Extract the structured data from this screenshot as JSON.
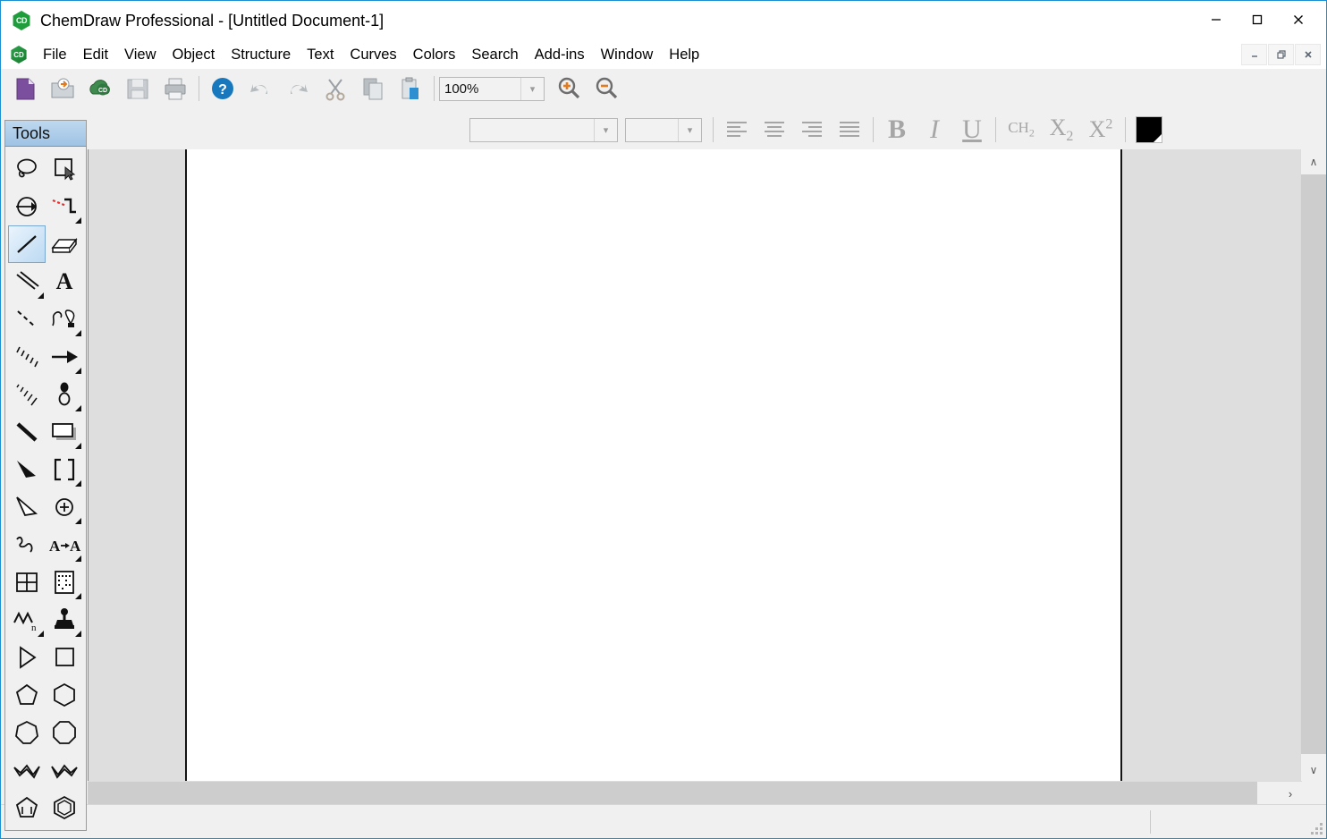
{
  "window": {
    "app_title": "ChemDraw Professional - [Untitled Document-1]",
    "app_icon": "chemdraw-hexagon-icon",
    "icon_text": "CD",
    "controls": {
      "minimize": "—",
      "maximize": "☐",
      "close": "✕"
    }
  },
  "mdi_controls": {
    "minimize": "–",
    "restore": "❐",
    "close": "✕"
  },
  "menu": {
    "icon": "chemdraw-document-icon",
    "icon_text": "CD",
    "items": [
      {
        "label": "File"
      },
      {
        "label": "Edit"
      },
      {
        "label": "View"
      },
      {
        "label": "Object"
      },
      {
        "label": "Structure"
      },
      {
        "label": "Text"
      },
      {
        "label": "Curves"
      },
      {
        "label": "Colors"
      },
      {
        "label": "Search"
      },
      {
        "label": "Add-ins"
      },
      {
        "label": "Window"
      },
      {
        "label": "Help"
      }
    ]
  },
  "main_toolbar": {
    "buttons": [
      {
        "name": "new-document-button",
        "icon": "new-document-icon",
        "enabled": true
      },
      {
        "name": "open-document-button",
        "icon": "open-folder-icon",
        "enabled": true
      },
      {
        "name": "chemdraw-cloud-button",
        "icon": "cloud-icon",
        "enabled": true
      },
      {
        "name": "save-button",
        "icon": "floppy-disk-icon",
        "enabled": false
      },
      {
        "name": "print-button",
        "icon": "printer-icon",
        "enabled": true
      },
      {
        "name": "help-button",
        "icon": "question-mark-icon",
        "enabled": true
      },
      {
        "name": "undo-button",
        "icon": "undo-arrow-icon",
        "enabled": false
      },
      {
        "name": "redo-button",
        "icon": "redo-arrow-icon",
        "enabled": false
      },
      {
        "name": "cut-button",
        "icon": "scissors-icon",
        "enabled": false
      },
      {
        "name": "copy-button",
        "icon": "copy-pages-icon",
        "enabled": false
      },
      {
        "name": "paste-button",
        "icon": "clipboard-icon",
        "enabled": false
      }
    ],
    "zoom": {
      "value": "100%",
      "zoom_in_icon": "magnifier-plus-icon",
      "zoom_out_icon": "magnifier-minus-icon"
    }
  },
  "format_toolbar": {
    "font_family": {
      "value": "",
      "placeholder": ""
    },
    "font_size": {
      "value": "",
      "placeholder": ""
    },
    "align_buttons": [
      {
        "name": "align-left-button",
        "icon": "align-left-icon"
      },
      {
        "name": "align-center-button",
        "icon": "align-center-icon"
      },
      {
        "name": "align-right-button",
        "icon": "align-right-icon"
      },
      {
        "name": "align-justify-button",
        "icon": "align-justify-icon"
      }
    ],
    "bold_label": "B",
    "italic_label": "I",
    "underline_label": "U",
    "formula_label": "CH",
    "formula_sub": "2",
    "subscript_label": "X",
    "subscript_sub": "2",
    "superscript_label": "X",
    "superscript_sup": "2",
    "color_swatch": "#000000"
  },
  "tools_palette": {
    "title": "Tools",
    "selected_tool": "solid-bond-tool",
    "tools": [
      {
        "name": "lasso-select-tool",
        "icon": "lasso-icon",
        "has_submenu": false
      },
      {
        "name": "marquee-select-tool",
        "icon": "marquee-arrow-icon",
        "has_submenu": false
      },
      {
        "name": "move-rotate-tool",
        "icon": "circle-arrow-icon",
        "has_submenu": false
      },
      {
        "name": "reaction-bond-tool",
        "icon": "dashed-red-bond-icon",
        "has_submenu": true
      },
      {
        "name": "solid-bond-tool",
        "icon": "solid-bond-icon",
        "has_submenu": false
      },
      {
        "name": "eraser-tool",
        "icon": "eraser-icon",
        "has_submenu": false
      },
      {
        "name": "multiple-bond-tool",
        "icon": "double-bond-icon",
        "has_submenu": true
      },
      {
        "name": "text-tool",
        "icon": "letter-a-icon",
        "has_submenu": false
      },
      {
        "name": "dashed-bond-tool",
        "icon": "dashed-bond-icon",
        "has_submenu": false
      },
      {
        "name": "pen-tool",
        "icon": "fountain-pen-icon",
        "has_submenu": true
      },
      {
        "name": "hashed-bond-tool",
        "icon": "hash-marks-icon",
        "has_submenu": false
      },
      {
        "name": "arrow-tool",
        "icon": "arrow-right-icon",
        "has_submenu": true
      },
      {
        "name": "hashed-wedge-tool",
        "icon": "hash-wedge-icon",
        "has_submenu": false
      },
      {
        "name": "orbital-tool",
        "icon": "orbital-icon",
        "has_submenu": true
      },
      {
        "name": "bold-bond-tool",
        "icon": "bold-bond-icon",
        "has_submenu": false
      },
      {
        "name": "frame-tool",
        "icon": "rectangle-frame-icon",
        "has_submenu": true
      },
      {
        "name": "wedge-bond-tool",
        "icon": "solid-wedge-icon",
        "has_submenu": false
      },
      {
        "name": "bracket-tool",
        "icon": "brackets-icon",
        "has_submenu": true
      },
      {
        "name": "hollow-wedge-tool",
        "icon": "hollow-wedge-icon",
        "has_submenu": false
      },
      {
        "name": "charge-tool",
        "icon": "circle-plus-icon",
        "has_submenu": true
      },
      {
        "name": "squiggle-bond-tool",
        "icon": "squiggle-icon",
        "has_submenu": false
      },
      {
        "name": "atom-replace-tool",
        "icon": "a-to-a-icon",
        "has_submenu": true
      },
      {
        "name": "table-tool",
        "icon": "grid-table-icon",
        "has_submenu": false
      },
      {
        "name": "template-page-tool",
        "icon": "dotted-page-icon",
        "has_submenu": true
      },
      {
        "name": "polymer-tool",
        "icon": "polymer-chain-icon",
        "has_submenu": true
      },
      {
        "name": "stamp-tool",
        "icon": "rubber-stamp-icon",
        "has_submenu": true
      },
      {
        "name": "flip-tool",
        "icon": "triangle-play-icon",
        "has_submenu": false
      },
      {
        "name": "square-tool",
        "icon": "square-icon",
        "has_submenu": false
      },
      {
        "name": "cyclopentane-tool",
        "icon": "pentagon-icon",
        "has_submenu": false
      },
      {
        "name": "cyclohexane-tool",
        "icon": "hexagon-icon",
        "has_submenu": false
      },
      {
        "name": "cycloheptane-tool",
        "icon": "heptagon-icon",
        "has_submenu": false
      },
      {
        "name": "cyclooctane-tool",
        "icon": "octagon-icon",
        "has_submenu": false
      },
      {
        "name": "chair-left-tool",
        "icon": "cyclohexane-chair-left-icon",
        "has_submenu": false
      },
      {
        "name": "chair-right-tool",
        "icon": "cyclohexane-chair-right-icon",
        "has_submenu": false
      },
      {
        "name": "cyclopentadiene-tool",
        "icon": "cyclopentadiene-icon",
        "has_submenu": false
      },
      {
        "name": "benzene-tool",
        "icon": "benzene-ring-icon",
        "has_submenu": false
      }
    ]
  },
  "document": {
    "page_background": "#ffffff",
    "workspace_background": "#dedede"
  },
  "scrollbars": {
    "vertical_up": "∧",
    "vertical_down": "∨",
    "horizontal_right": "›"
  },
  "statusbar": {
    "text": ""
  }
}
